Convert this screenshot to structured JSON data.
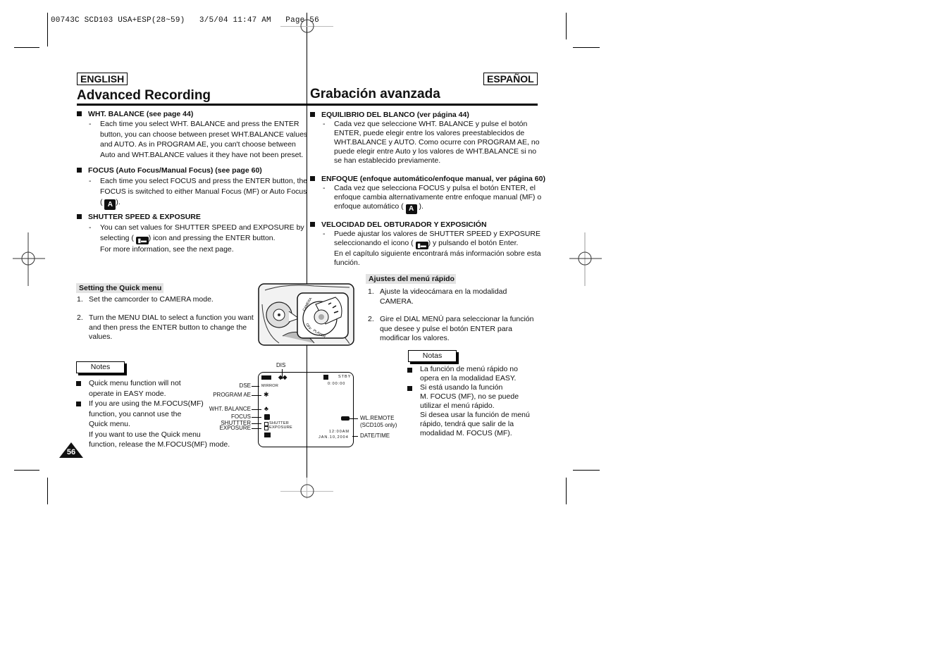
{
  "print_header": {
    "job_id": "00743C SCD103 USA+ESP(28~59)",
    "timestamp": "3/5/04 11:47 AM",
    "page_label": "Page 56"
  },
  "english": {
    "lang_badge": "ENGLISH",
    "title": "Advanced Recording",
    "sections": [
      {
        "heading": "WHT. BALANCE (see page 44)",
        "lines": [
          "Each time you select WHT. BALANCE and press the ENTER",
          "button, you can choose between preset WHT.BALANCE values",
          "and AUTO. As in PROGRAM AE, you can't choose between",
          "Auto and WHT.BALANCE values it they have not been preset."
        ]
      },
      {
        "heading": "FOCUS (Auto Focus/Manual Focus) (see page 60)",
        "lines": [
          "Each time you select FOCUS and press the ENTER button, the",
          "FOCUS is switched to either Manual Focus (MF) or Auto Focus"
        ],
        "icon_line_prefix": "(",
        "icon_line_suffix": ").",
        "icon": "auto-focus-icon"
      },
      {
        "heading": "SHUTTER SPEED & EXPOSURE",
        "line1": "You can set values for SHUTTER SPEED and EXPOSURE by",
        "line2_prefix": "selecting (",
        "line2_suffix": ") icon and pressing the ENTER button.",
        "line3": "For more information, see the next page.",
        "icon": "shutter-exposure-icon"
      }
    ],
    "quick_menu": {
      "heading": "Setting the Quick menu",
      "steps": [
        {
          "num": "1.",
          "text": "Set the camcorder to CAMERA mode."
        },
        {
          "num": "2.",
          "lines": [
            "Turn the MENU DIAL to select a function you want",
            "and then press the ENTER button to change the",
            "values."
          ]
        }
      ]
    },
    "notes": {
      "label": "Notes",
      "items": [
        {
          "lines": [
            "Quick menu function will not",
            "operate in EASY mode."
          ]
        },
        {
          "lines": [
            "If you are using the M.FOCUS(MF)",
            "function, you cannot use the",
            "Quick menu.",
            "If you want to use the Quick menu",
            "function, release the M.FOCUS(MF) mode."
          ]
        }
      ]
    },
    "page_number": "56"
  },
  "dial_illustration": {
    "dial_labels": [
      "CAMERA",
      "OFF",
      "PLAYER"
    ]
  },
  "lcd_diagram": {
    "callouts_left": [
      "DSE",
      "PROGRAM AE",
      "WHT. BALANCE",
      "FOCUS",
      "SHUTTTER",
      "EXPOSURE"
    ],
    "callout_top": "DIS",
    "callouts_right": [
      "WL.REMOTE",
      "(SCD105 only)",
      "DATE/TIME"
    ],
    "screen": {
      "dse_value": "MIRROR",
      "status": "STBY",
      "counter": "0:00:00",
      "shutter_label": "SHUTTER",
      "exposure_label": "EXPOSURE",
      "time": "12:00AM",
      "date": "JAN.10,2004"
    }
  },
  "spanish": {
    "lang_badge": "ESPAÑOL",
    "title": "Grabación avanzada",
    "sections": [
      {
        "heading": "EQUILIBRIO DEL BLANCO (ver página 44)",
        "lines": [
          "Cada vez que seleccione WHT. BALANCE y pulse el botón",
          "ENTER, puede elegir entre los valores preestablecidos de",
          "WHT.BALANCE y AUTO. Como ocurre con PROGRAM AE, no",
          "puede elegir entre Auto y los valores de WHT.BALANCE si no",
          "se han establecido previamente."
        ]
      },
      {
        "heading": "ENFOQUE (enfoque automático/enfoque manual, ver página 60)",
        "lines": [
          "Cada vez que selecciona FOCUS y pulsa el botón ENTER, el",
          "enfoque cambia alternativamente entre enfoque manual (MF) o"
        ],
        "icon_line_prefix": "enfoque automático (",
        "icon_line_suffix": ").",
        "icon": "auto-focus-icon"
      },
      {
        "heading": "VELOCIDAD DEL OBTURADOR Y EXPOSICIÓN",
        "line1": "Puede ajustar los valores de SHUTTER SPEED y EXPOSURE",
        "line2_prefix": "seleccionando el icono (",
        "line2_suffix": ") y pulsando el botón Enter.",
        "line3": "En el capítulo siguiente encontrará más información sobre esta",
        "line4": "función.",
        "icon": "shutter-exposure-icon"
      }
    ],
    "quick_menu": {
      "heading": "Ajustes del menú rápido",
      "steps": [
        {
          "num": "1.",
          "lines": [
            "Ajuste la videocámara en la modalidad",
            "CAMERA."
          ]
        },
        {
          "num": "2.",
          "lines": [
            "Gire el DIAL MENÚ para seleccionar la función",
            "que desee y pulse el botón ENTER para",
            "modificar los valores."
          ]
        }
      ]
    },
    "notes": {
      "label": "Notas",
      "items": [
        {
          "lines": [
            "La función de menú rápido no",
            "opera en la modalidad EASY."
          ]
        },
        {
          "lines": [
            "Si está usando la función",
            "M. FOCUS (MF), no se puede",
            "utilizar el menú rápido.",
            "Si desea usar la función de menú",
            "rápido, tendrá que salir de la",
            "modalidad M. FOCUS (MF)."
          ]
        }
      ]
    }
  }
}
